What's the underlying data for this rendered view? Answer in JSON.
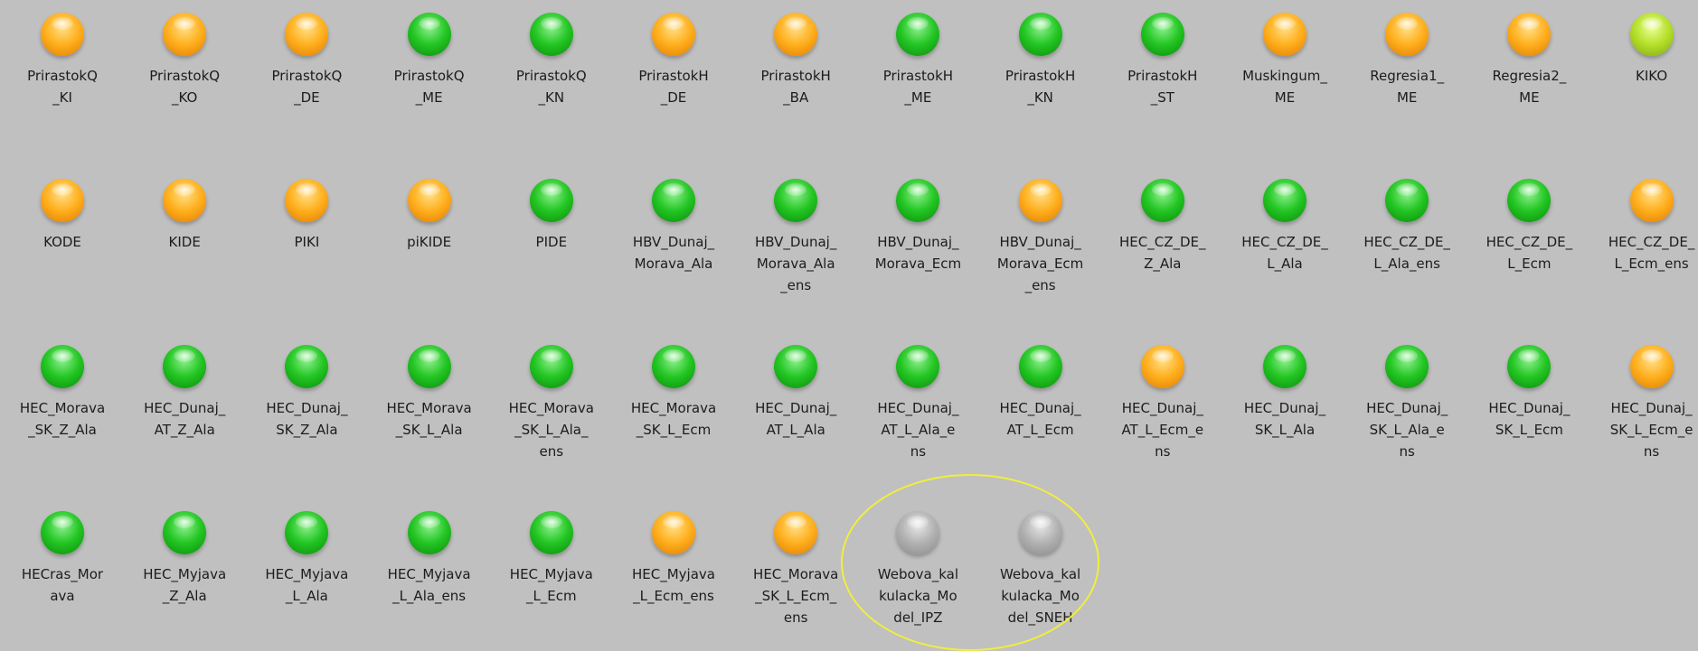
{
  "colors": {
    "background": "#c0c0c0",
    "orange": "#ff9e0a",
    "green": "#1fbf1f",
    "lime": "#a6d81e",
    "gray": "#a6a6a6",
    "highlight": "#f1ee3c"
  },
  "icon": "status-lamp-icon",
  "models": [
    {
      "label": "PrirastokQ\n_KI",
      "status": "orange"
    },
    {
      "label": "PrirastokQ\n_KO",
      "status": "orange"
    },
    {
      "label": "PrirastokQ\n_DE",
      "status": "orange"
    },
    {
      "label": "PrirastokQ\n_ME",
      "status": "green"
    },
    {
      "label": "PrirastokQ\n_KN",
      "status": "green"
    },
    {
      "label": "PrirastokH\n_DE",
      "status": "orange"
    },
    {
      "label": "PrirastokH\n_BA",
      "status": "orange"
    },
    {
      "label": "PrirastokH\n_ME",
      "status": "green"
    },
    {
      "label": "PrirastokH\n_KN",
      "status": "green"
    },
    {
      "label": "PrirastokH\n_ST",
      "status": "green"
    },
    {
      "label": "Muskingum_\nME",
      "status": "orange"
    },
    {
      "label": "Regresia1_\nME",
      "status": "orange"
    },
    {
      "label": "Regresia2_\nME",
      "status": "orange"
    },
    {
      "label": "KIKO",
      "status": "lime"
    },
    {
      "label": "KODE",
      "status": "orange"
    },
    {
      "label": "KIDE",
      "status": "orange"
    },
    {
      "label": "PIKI",
      "status": "orange"
    },
    {
      "label": "piKIDE",
      "status": "orange"
    },
    {
      "label": "PIDE",
      "status": "green"
    },
    {
      "label": "HBV_Dunaj_\nMorava_Ala",
      "status": "green"
    },
    {
      "label": "HBV_Dunaj_\nMorava_Ala\n_ens",
      "status": "green"
    },
    {
      "label": "HBV_Dunaj_\nMorava_Ecm",
      "status": "green"
    },
    {
      "label": "HBV_Dunaj_\nMorava_Ecm\n_ens",
      "status": "orange"
    },
    {
      "label": "HEC_CZ_DE_\nZ_Ala",
      "status": "green"
    },
    {
      "label": "HEC_CZ_DE_\nL_Ala",
      "status": "green"
    },
    {
      "label": "HEC_CZ_DE_\nL_Ala_ens",
      "status": "green"
    },
    {
      "label": "HEC_CZ_DE_\nL_Ecm",
      "status": "green"
    },
    {
      "label": "HEC_CZ_DE_\nL_Ecm_ens",
      "status": "orange"
    },
    {
      "label": "HEC_Morava\n_SK_Z_Ala",
      "status": "green"
    },
    {
      "label": "HEC_Dunaj_\nAT_Z_Ala",
      "status": "green"
    },
    {
      "label": "HEC_Dunaj_\nSK_Z_Ala",
      "status": "green"
    },
    {
      "label": "HEC_Morava\n_SK_L_Ala",
      "status": "green"
    },
    {
      "label": "HEC_Morava\n_SK_L_Ala_\nens",
      "status": "green"
    },
    {
      "label": "HEC_Morava\n_SK_L_Ecm",
      "status": "green"
    },
    {
      "label": "HEC_Dunaj_\nAT_L_Ala",
      "status": "green"
    },
    {
      "label": "HEC_Dunaj_\nAT_L_Ala_e\nns",
      "status": "green"
    },
    {
      "label": "HEC_Dunaj_\nAT_L_Ecm",
      "status": "green"
    },
    {
      "label": "HEC_Dunaj_\nAT_L_Ecm_e\nns",
      "status": "orange"
    },
    {
      "label": "HEC_Dunaj_\nSK_L_Ala",
      "status": "green"
    },
    {
      "label": "HEC_Dunaj_\nSK_L_Ala_e\nns",
      "status": "green"
    },
    {
      "label": "HEC_Dunaj_\nSK_L_Ecm",
      "status": "green"
    },
    {
      "label": "HEC_Dunaj_\nSK_L_Ecm_e\nns",
      "status": "orange"
    },
    {
      "label": "HECras_Mor\nava",
      "status": "green"
    },
    {
      "label": "HEC_Myjava\n_Z_Ala",
      "status": "green"
    },
    {
      "label": "HEC_Myjava\n_L_Ala",
      "status": "green"
    },
    {
      "label": "HEC_Myjava\n_L_Ala_ens",
      "status": "green"
    },
    {
      "label": "HEC_Myjava\n_L_Ecm",
      "status": "green"
    },
    {
      "label": "HEC_Myjava\n_L_Ecm_ens",
      "status": "orange"
    },
    {
      "label": "HEC_Morava\n_SK_L_Ecm_\nens",
      "status": "orange"
    },
    {
      "label": "Webova_kal\nkulacka_Mo\ndel_IPZ",
      "status": "gray"
    },
    {
      "label": "Webova_kal\nkulacka_Mo\ndel_SNEH",
      "status": "gray"
    }
  ]
}
